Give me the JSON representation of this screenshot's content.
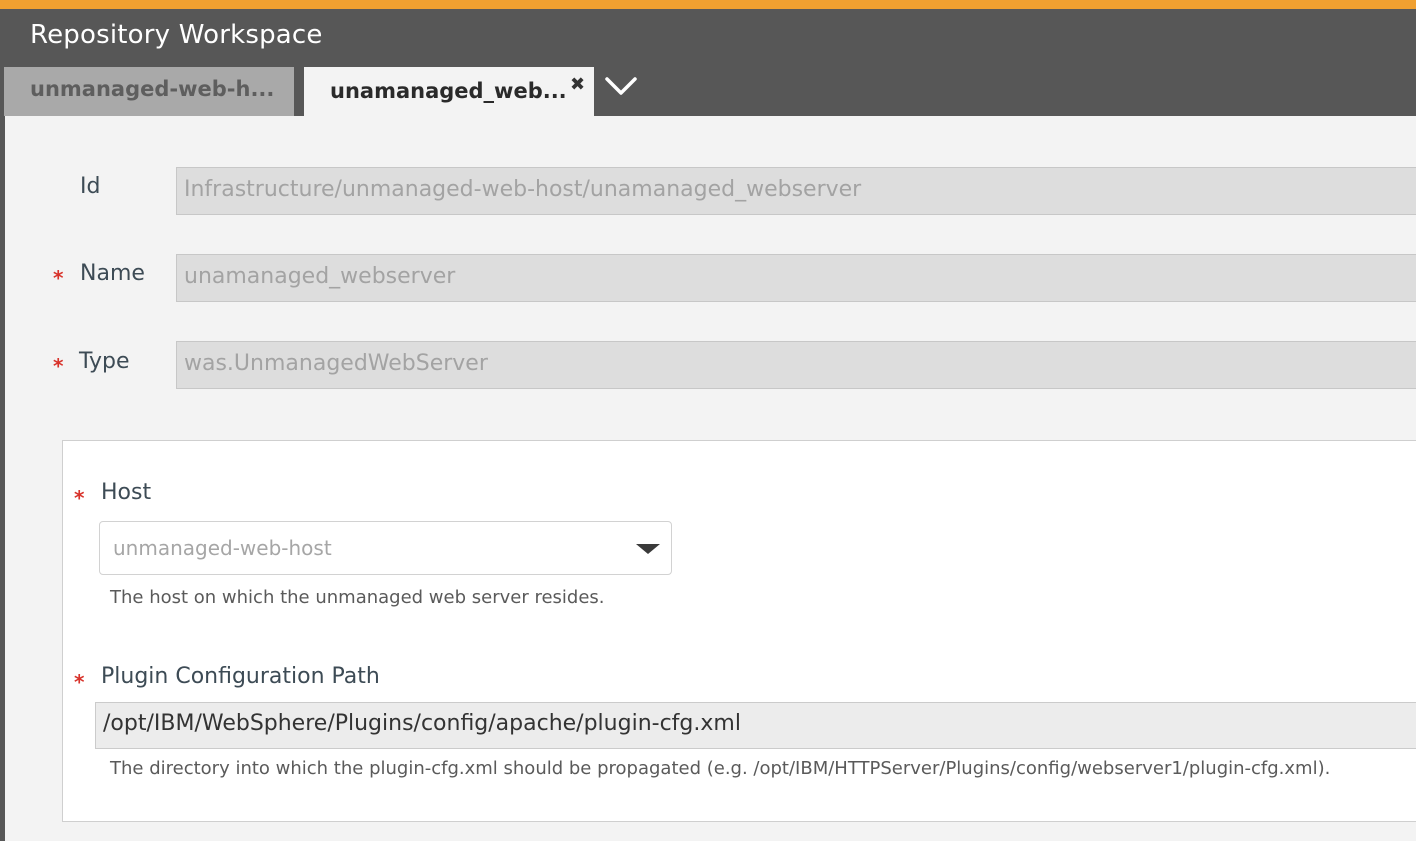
{
  "window": {
    "title": "Repository Workspace",
    "accent_color": "#f0a030"
  },
  "tabs": [
    {
      "label": "unmanaged-web-h...",
      "active": false
    },
    {
      "label": "unamanaged_web...",
      "active": true,
      "close_icon": "close-icon"
    }
  ],
  "tab_overflow_icon": "chevron-down-icon",
  "form": {
    "id": {
      "label": "Id",
      "value": "Infrastructure/unmanaged-web-host/unamanaged_webserver"
    },
    "name": {
      "label": "Name",
      "value": "unamanaged_webserver",
      "required_mark": "*"
    },
    "type": {
      "label": "Type",
      "value": "was.UnmanagedWebServer",
      "required_mark": "*"
    }
  },
  "properties": {
    "host": {
      "label": "Host",
      "required_mark": "*",
      "selected": "unmanaged-web-host",
      "help": "The host on which the unmanaged web server resides."
    },
    "plugin_path": {
      "label": "Plugin Configuration Path",
      "required_mark": "*",
      "value": "/opt/IBM/WebSphere/Plugins/config/apache/plugin-cfg.xml",
      "help": "The directory into which the plugin-cfg.xml should be propagated (e.g. /opt/IBM/HTTPServer/Plugins/config/webserver1/plugin-cfg.xml)."
    }
  },
  "colors": {
    "header_bg": "#575757",
    "required": "#d8332b"
  }
}
